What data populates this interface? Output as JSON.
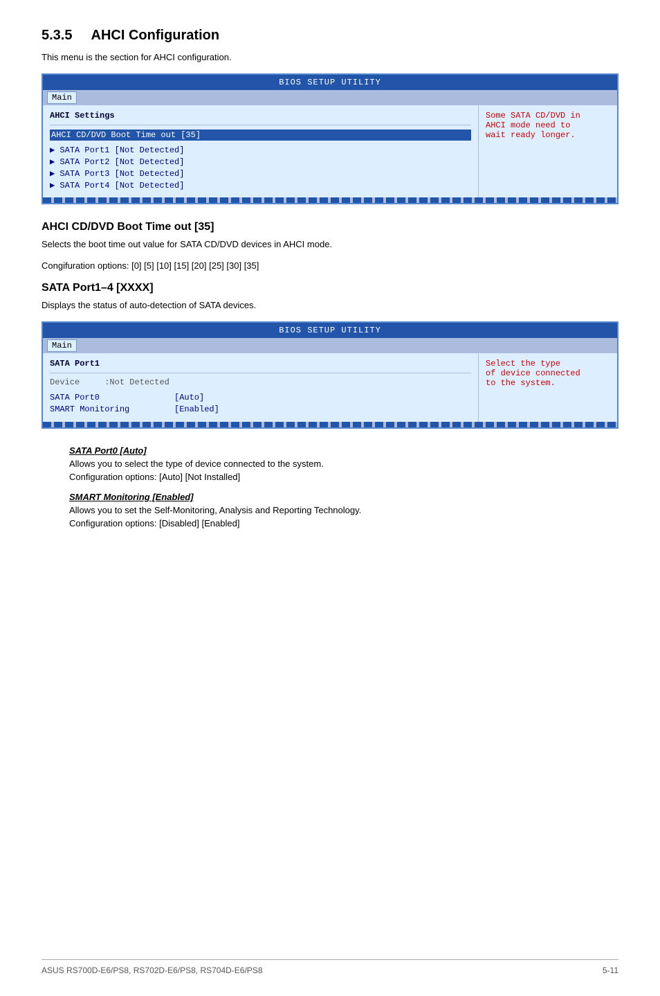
{
  "section": {
    "number": "5.3.5",
    "title": "AHCI Configuration",
    "intro": "This menu is the section for AHCI configuration."
  },
  "bios_panel_1": {
    "header": "BIOS SETUP UTILITY",
    "tab": "Main",
    "left": {
      "section_label": "AHCI Settings",
      "highlighted_item": "AHCI CD/DVD Boot Time out     [35]",
      "arrow_items": [
        "▶ SATA Port1 [Not Detected]",
        "▶ SATA Port2 [Not Detected]",
        "▶ SATA Port3 [Not Detected]",
        "▶ SATA Port4 [Not Detected]"
      ]
    },
    "right": {
      "text": "Some SATA CD/DVD in\nAHCI mode need to\nwait ready longer."
    }
  },
  "subsection_1": {
    "title": "AHCI CD/DVD Boot Time out [35]",
    "description": "Selects the boot time out value for SATA CD/DVD devices in AHCI mode.",
    "config_options": "Congifuration options: [0] [5] [10] [15] [20] [25] [30] [35]"
  },
  "subsection_2": {
    "title": "SATA Port1–4 [XXXX]",
    "description": "Displays the status of auto-detection of SATA devices."
  },
  "bios_panel_2": {
    "header": "BIOS SETUP UTILITY",
    "tab": "Main",
    "left": {
      "section_label": "SATA Port1",
      "device_label": "Device",
      "device_value": ":Not Detected",
      "items": [
        {
          "key": "SATA Port0",
          "value": "[Auto]"
        },
        {
          "key": "SMART Monitoring",
          "value": "[Enabled]"
        }
      ]
    },
    "right": {
      "text": "Select the type\nof device connected\nto the system."
    }
  },
  "sata_port0": {
    "label": "SATA Port0 [Auto]",
    "description": "Allows you to select the type of device connected to the system.",
    "config_options": "Configuration options: [Auto] [Not Installed]"
  },
  "smart_monitoring": {
    "label": "SMART Monitoring [Enabled]",
    "description": "Allows you to set the Self-Monitoring, Analysis and Reporting Technology.",
    "config_options": "Configuration options: [Disabled] [Enabled]"
  },
  "footer": {
    "left": "ASUS RS700D-E6/PS8, RS702D-E6/PS8, RS704D-E6/PS8",
    "right": "5-11"
  }
}
